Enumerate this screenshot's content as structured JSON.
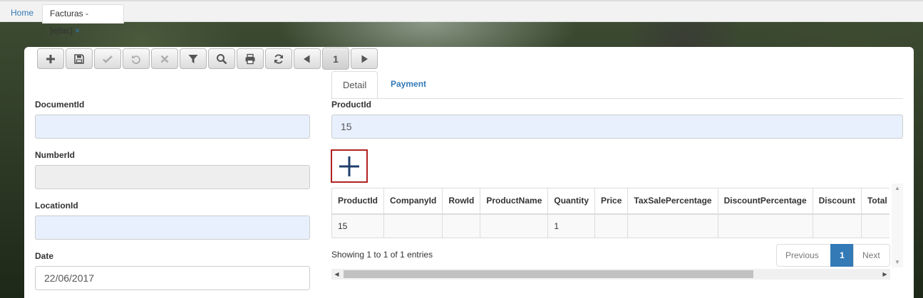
{
  "tabs": {
    "home": "Home",
    "active": "Facturas -[ejfac]",
    "close": "×"
  },
  "toolbar": {
    "buttons": [
      {
        "icon": "plus-icon",
        "enabled": true
      },
      {
        "icon": "save-icon",
        "enabled": true
      },
      {
        "icon": "check-icon",
        "enabled": false
      },
      {
        "icon": "undo-icon",
        "enabled": false
      },
      {
        "icon": "close-icon",
        "enabled": false
      },
      {
        "icon": "filter-icon",
        "enabled": true
      },
      {
        "icon": "search-icon",
        "enabled": true
      },
      {
        "icon": "print-icon",
        "enabled": true
      },
      {
        "icon": "refresh-icon",
        "enabled": true
      },
      {
        "icon": "prev-icon",
        "enabled": true
      }
    ],
    "page": "1"
  },
  "form": {
    "document_id": {
      "label": "DocumentId",
      "value": ""
    },
    "number_id": {
      "label": "NumberId",
      "value": ""
    },
    "location_id": {
      "label": "LocationId",
      "value": ""
    },
    "date": {
      "label": "Date",
      "value": "22/06/2017"
    }
  },
  "detail_tabs": {
    "detail": "Detail",
    "payment": "Payment"
  },
  "detail": {
    "product_id": {
      "label": "ProductId",
      "value": "15"
    },
    "grid": {
      "columns": [
        "ProductId",
        "CompanyId",
        "RowId",
        "ProductName",
        "Quantity",
        "Price",
        "TaxSalePercentage",
        "DiscountPercentage",
        "Discount",
        "Total"
      ],
      "rows": [
        [
          "15",
          "",
          "",
          "",
          "1",
          "",
          "",
          "",
          "",
          ""
        ]
      ]
    },
    "info": "Showing 1 to 1 of 1 entries",
    "pager": {
      "previous": "Previous",
      "current": "1",
      "next": "Next"
    }
  }
}
